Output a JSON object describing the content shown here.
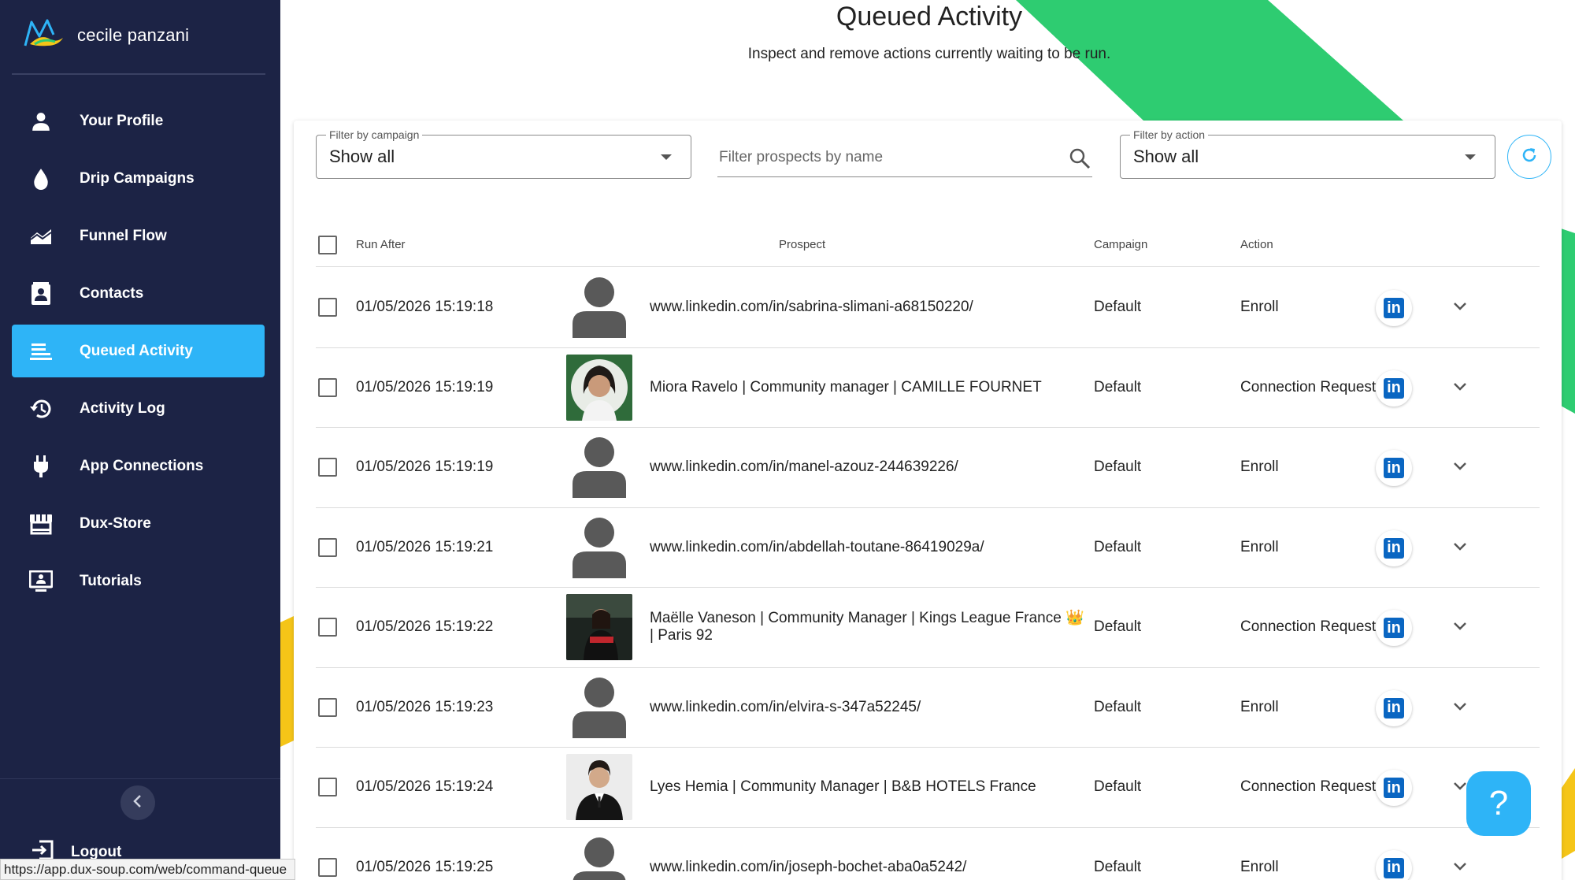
{
  "brand": {
    "name": "cecile panzani"
  },
  "sidebar": {
    "items": [
      {
        "label": "Your Profile",
        "icon": "person-icon"
      },
      {
        "label": "Drip Campaigns",
        "icon": "drop-icon"
      },
      {
        "label": "Funnel Flow",
        "icon": "area-chart-icon"
      },
      {
        "label": "Contacts",
        "icon": "contact-card-icon"
      },
      {
        "label": "Queued Activity",
        "icon": "queue-icon",
        "active": true
      },
      {
        "label": "Activity Log",
        "icon": "history-icon"
      },
      {
        "label": "App Connections",
        "icon": "plug-icon"
      },
      {
        "label": "Dux-Store",
        "icon": "store-icon"
      },
      {
        "label": "Tutorials",
        "icon": "monitor-person-icon"
      }
    ],
    "logout_label": "Logout"
  },
  "status_url": "https://app.dux-soup.com/web/command-queue",
  "header": {
    "title": "Queued Activity",
    "subtitle": "Inspect and remove actions currently waiting to be run."
  },
  "filters": {
    "campaign": {
      "legend": "Filter by campaign",
      "value": "Show all"
    },
    "search": {
      "placeholder": "Filter prospects by name"
    },
    "action": {
      "legend": "Filter by action",
      "value": "Show all"
    }
  },
  "table": {
    "headers": {
      "run_after": "Run After",
      "prospect": "Prospect",
      "campaign": "Campaign",
      "action": "Action"
    },
    "rows": [
      {
        "run_after": "01/05/2026 15:19:18",
        "avatar": "placeholder",
        "prospect": "www.linkedin.com/in/sabrina-slimani-a68150220/",
        "campaign": "Default",
        "action": "Enroll"
      },
      {
        "run_after": "01/05/2026 15:19:19",
        "avatar": "photo",
        "prospect": "Miora Ravelo | Community manager  | CAMILLE FOURNET",
        "campaign": "Default",
        "action": "Connection Request"
      },
      {
        "run_after": "01/05/2026 15:19:19",
        "avatar": "placeholder",
        "prospect": "www.linkedin.com/in/manel-azouz-244639226/",
        "campaign": "Default",
        "action": "Enroll"
      },
      {
        "run_after": "01/05/2026 15:19:21",
        "avatar": "placeholder",
        "prospect": "www.linkedin.com/in/abdellah-toutane-86419029a/",
        "campaign": "Default",
        "action": "Enroll"
      },
      {
        "run_after": "01/05/2026 15:19:22",
        "avatar": "photo",
        "prospect": "Maëlle Vaneson | Community Manager | Kings League France 👑 | Paris 92",
        "campaign": "Default",
        "action": "Connection Request"
      },
      {
        "run_after": "01/05/2026 15:19:23",
        "avatar": "placeholder",
        "prospect": "www.linkedin.com/in/elvira-s-347a52245/",
        "campaign": "Default",
        "action": "Enroll"
      },
      {
        "run_after": "01/05/2026 15:19:24",
        "avatar": "photo",
        "prospect": "Lyes Hemia | Community Manager  | B&B HOTELS France",
        "campaign": "Default",
        "action": "Connection Request"
      },
      {
        "run_after": "01/05/2026 15:19:25",
        "avatar": "placeholder",
        "prospect": "www.linkedin.com/in/joseph-bochet-aba0a5242/",
        "campaign": "Default",
        "action": "Enroll"
      }
    ],
    "linkedin_icon_text": "in"
  },
  "help": {
    "label": "?"
  },
  "colors": {
    "sidebar_bg": "#1c2345",
    "accent": "#2eb4f7",
    "linkedin": "#0a66c2",
    "deco_green": "#2ecc71",
    "deco_yellow": "#f5c518"
  }
}
